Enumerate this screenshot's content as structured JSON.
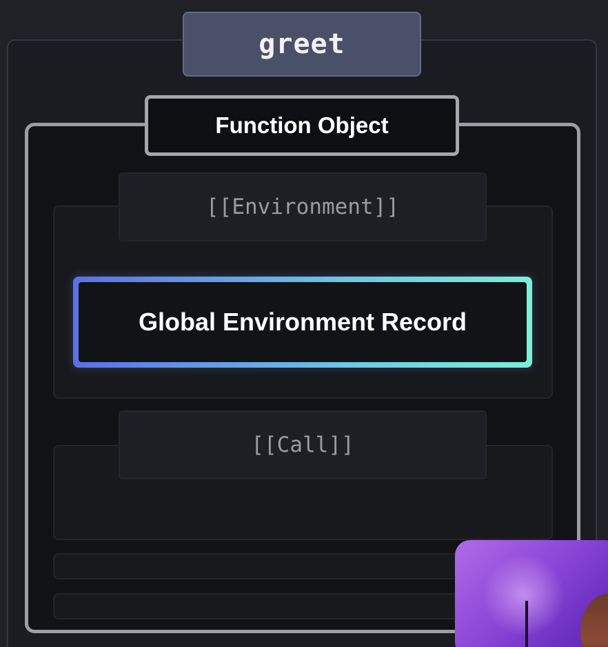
{
  "variable": {
    "name": "greet"
  },
  "function_object": {
    "title": "Function Object",
    "slots": [
      {
        "name": "[[Environment]]",
        "value": "Global Environment Record"
      },
      {
        "name": "[[Call]]",
        "value": ""
      }
    ]
  },
  "colors": {
    "background": "#1f2126",
    "variable_box": "#4a5068",
    "function_border": "#9b9ea3",
    "record_gradient_start": "#5b6fe8",
    "record_gradient_end": "#7af0d8"
  }
}
